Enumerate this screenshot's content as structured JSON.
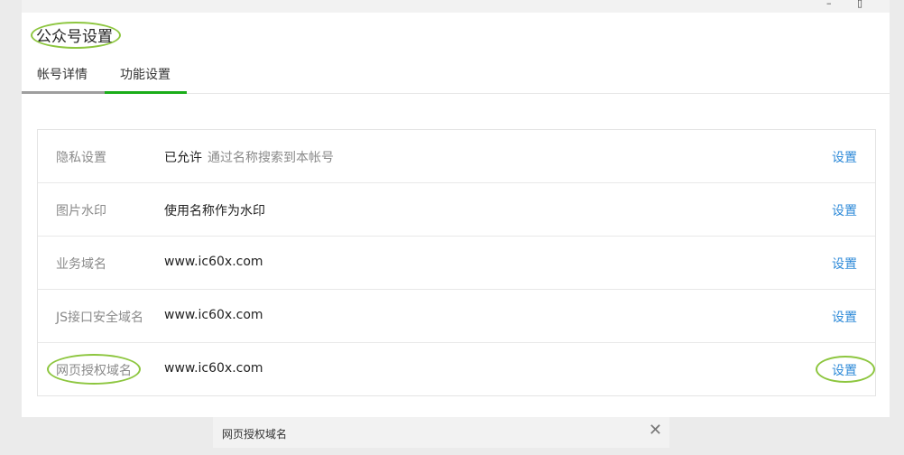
{
  "window": {
    "minimize_glyph": "–",
    "maximize_glyph": "▯"
  },
  "page": {
    "title": "公众号设置"
  },
  "tabs": [
    {
      "label": "帐号详情"
    },
    {
      "label": "功能设置"
    }
  ],
  "settings": {
    "rows": [
      {
        "label": "隐私设置",
        "value": "已允许",
        "note": "通过名称搜索到本帐号",
        "action": "设置"
      },
      {
        "label": "图片水印",
        "value": "使用名称作为水印",
        "note": "",
        "action": "设置"
      },
      {
        "label": "业务域名",
        "value": "www.ic60x.com",
        "note": "",
        "action": "设置"
      },
      {
        "label": "JS接口安全域名",
        "value": "www.ic60x.com",
        "note": "",
        "action": "设置"
      },
      {
        "label": "网页授权域名",
        "value": "www.ic60x.com",
        "note": "",
        "action": "设置"
      }
    ]
  },
  "toast": {
    "text": "网页授权域名",
    "close_icon": "close-icon"
  },
  "colors": {
    "accent_green": "#1aad19",
    "link_blue": "#2e8ad8",
    "highlight_oval": "#8dc63f"
  }
}
